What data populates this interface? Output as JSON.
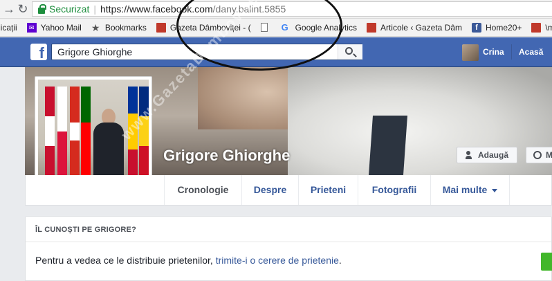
{
  "browser": {
    "secure_label": "Securizat",
    "url_host": "https://www.facebook.com",
    "url_path": "/dany.balint.5855",
    "bookmarks": [
      {
        "label": "licații",
        "icon": "apps-icon"
      },
      {
        "label": "Yahoo Mail",
        "icon": "yahoo-icon"
      },
      {
        "label": "Bookmarks",
        "icon": "star-icon"
      },
      {
        "label": "Gazeta Dâmboviței - (",
        "icon": "gazeta-icon"
      },
      {
        "label": "",
        "icon": "document-icon"
      },
      {
        "label": "Google Analytics",
        "icon": "google-icon"
      },
      {
        "label": "Articole ‹ Gazeta Dâm",
        "icon": "gazeta-icon"
      },
      {
        "label": "Home20+",
        "icon": "facebook-icon"
      },
      {
        "label": "\\m",
        "icon": "gazeta-icon"
      }
    ]
  },
  "fb": {
    "search_value": "Grigore Ghiorghe",
    "user_name": "Crina",
    "home_label": "Acasă"
  },
  "profile": {
    "name": "Grigore Ghiorghe",
    "add_friend": "Adaugă",
    "message": "M"
  },
  "tabs": [
    {
      "label": "Cronologie"
    },
    {
      "label": "Despre"
    },
    {
      "label": "Prieteni"
    },
    {
      "label": "Fotografii"
    },
    {
      "label": "Mai multe"
    }
  ],
  "card": {
    "title": "ÎL CUNOȘTI PE GRIGORE?",
    "text_before": "Pentru a vedea ce le distribuie prietenilor, ",
    "link_text": "trimite-i o cerere de prietenie",
    "text_after": "."
  },
  "watermark": "www.GazetaDambovitei.ro",
  "colors": {
    "fb_blue": "#4267b2",
    "link": "#365899",
    "secure_green": "#1e8e3e",
    "button_green": "#42b72a"
  }
}
